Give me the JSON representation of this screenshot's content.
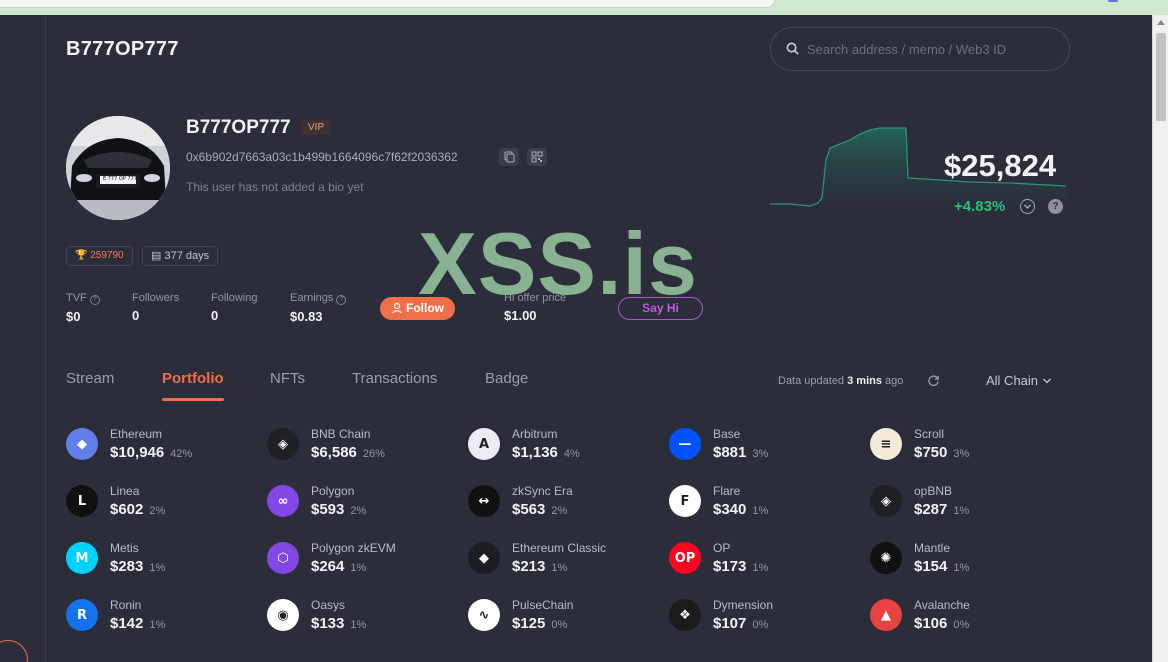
{
  "header": {
    "title": "B777OP777",
    "search_placeholder": "Search address / memo / Web3 ID"
  },
  "profile": {
    "username": "B777OP777",
    "vip_label": "VIP",
    "address": "0x6b902d7663a03c1b499b1664096c7f62f2036362",
    "bio": "This user has not added a bio yet",
    "rank": "259790",
    "days": "377 days",
    "avatar_plate": "Е 777 ОР 777"
  },
  "stats": [
    {
      "label": "TVF",
      "value": "$0",
      "help": true
    },
    {
      "label": "Followers",
      "value": "0",
      "help": false
    },
    {
      "label": "Following",
      "value": "0",
      "help": false
    },
    {
      "label": "Earnings",
      "value": "$0.83",
      "help": true
    }
  ],
  "actions": {
    "follow_label": "Follow",
    "offer_label": "Hi offer price",
    "offer_value": "$1.00",
    "sayhi_label": "Say Hi"
  },
  "balance": {
    "total": "$25,824",
    "change": "+4.83%",
    "colors": {
      "up": "#2bbf79",
      "accent": "#ef6f4b"
    }
  },
  "watermark": "XSS.is",
  "tabs": [
    {
      "label": "Stream",
      "active": false
    },
    {
      "label": "Portfolio",
      "active": true
    },
    {
      "label": "NFTs",
      "active": false
    },
    {
      "label": "Transactions",
      "active": false
    },
    {
      "label": "Badge",
      "active": false
    }
  ],
  "update_info": {
    "prefix": "Data updated",
    "time": "3 mins",
    "suffix": "ago"
  },
  "chain_filter": "All Chain",
  "chains": [
    {
      "name": "Ethereum",
      "amount": "$10,946",
      "percent": "42%",
      "icon": "ethereum-icon",
      "color": "#627eea",
      "glyph": "◆"
    },
    {
      "name": "BNB Chain",
      "amount": "$6,586",
      "percent": "26%",
      "icon": "bnb-icon",
      "color": "#1e2026",
      "glyph": "◈"
    },
    {
      "name": "Arbitrum",
      "amount": "$1,136",
      "percent": "4%",
      "icon": "arbitrum-icon",
      "color": "#e9eef5",
      "glyph": "A"
    },
    {
      "name": "Base",
      "amount": "$881",
      "percent": "3%",
      "icon": "base-icon",
      "color": "#0052ff",
      "glyph": "—"
    },
    {
      "name": "Scroll",
      "amount": "$750",
      "percent": "3%",
      "icon": "scroll-icon",
      "color": "#f2e9d6",
      "glyph": "≡"
    },
    {
      "name": "Linea",
      "amount": "$602",
      "percent": "2%",
      "icon": "linea-icon",
      "color": "#111111",
      "glyph": "L"
    },
    {
      "name": "Polygon",
      "amount": "$593",
      "percent": "2%",
      "icon": "polygon-icon",
      "color": "#8247e5",
      "glyph": "∞"
    },
    {
      "name": "zkSync Era",
      "amount": "$563",
      "percent": "2%",
      "icon": "zksync-icon",
      "color": "#111111",
      "glyph": "↔"
    },
    {
      "name": "Flare",
      "amount": "$340",
      "percent": "1%",
      "icon": "flare-icon",
      "color": "#ffffff",
      "glyph": "F"
    },
    {
      "name": "opBNB",
      "amount": "$287",
      "percent": "1%",
      "icon": "opbnb-icon",
      "color": "#1e2026",
      "glyph": "◈"
    },
    {
      "name": "Metis",
      "amount": "$283",
      "percent": "1%",
      "icon": "metis-icon",
      "color": "#00d2ff",
      "glyph": "M"
    },
    {
      "name": "Polygon zkEVM",
      "amount": "$264",
      "percent": "1%",
      "icon": "polygon-zkevm-icon",
      "color": "#8247e5",
      "glyph": "⬡"
    },
    {
      "name": "Ethereum Classic",
      "amount": "$213",
      "percent": "1%",
      "icon": "ethereum-classic-icon",
      "color": "#1b1d22",
      "glyph": "◆"
    },
    {
      "name": "OP",
      "amount": "$173",
      "percent": "1%",
      "icon": "op-icon",
      "color": "#ff0420",
      "glyph": "OP"
    },
    {
      "name": "Mantle",
      "amount": "$154",
      "percent": "1%",
      "icon": "mantle-icon",
      "color": "#111111",
      "glyph": "✺"
    },
    {
      "name": "Ronin",
      "amount": "$142",
      "percent": "1%",
      "icon": "ronin-icon",
      "color": "#1273ea",
      "glyph": "R"
    },
    {
      "name": "Oasys",
      "amount": "$133",
      "percent": "1%",
      "icon": "oasys-icon",
      "color": "#ffffff",
      "glyph": "◉"
    },
    {
      "name": "PulseChain",
      "amount": "$125",
      "percent": "0%",
      "icon": "pulsechain-icon",
      "color": "#ffffff",
      "glyph": "∿"
    },
    {
      "name": "Dymension",
      "amount": "$107",
      "percent": "0%",
      "icon": "dymension-icon",
      "color": "#1b1b1b",
      "glyph": "❖"
    },
    {
      "name": "Avalanche",
      "amount": "$106",
      "percent": "0%",
      "icon": "avalanche-icon",
      "color": "#e84142",
      "glyph": "▲"
    }
  ]
}
